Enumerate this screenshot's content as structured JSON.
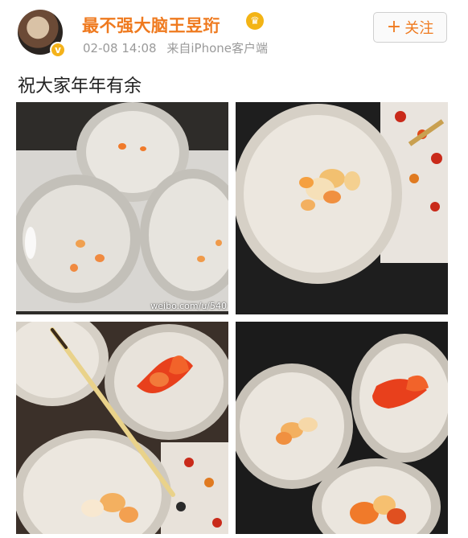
{
  "user": {
    "name": "最不强大脑王昱珩",
    "time": "02-08 14:08",
    "source": "来自iPhone客户端",
    "verified_badge": "v",
    "avatar_icon": "avatar-photo"
  },
  "follow": {
    "label": "关注",
    "plus": "+"
  },
  "post": {
    "text": "祝大家年年有余"
  },
  "images": {
    "watermark": "weibo.com/u/540"
  },
  "colors": {
    "username": "#ef7a1f",
    "meta": "#9a9a9a",
    "fish_orange": "#f07a2a",
    "fish_red": "#e8401c"
  }
}
